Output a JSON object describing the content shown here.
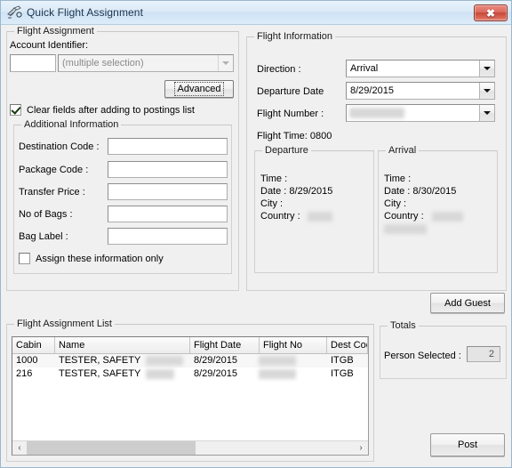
{
  "window": {
    "title": "Quick Flight Assignment",
    "icon": "flight-assignment-icon",
    "close_label": "✕"
  },
  "flight_assignment": {
    "group_title": "Flight Assignment",
    "account_identifier_label": "Account Identifier:",
    "account_identifier_value": "",
    "account_selection_value": "(multiple selection)",
    "advanced_button": "Advanced",
    "clear_fields_checkbox": {
      "label": "Clear fields after adding to postings list",
      "checked": true
    },
    "additional_information": {
      "group_title": "Additional Information",
      "fields": [
        {
          "label": "Destination Code :",
          "value": ""
        },
        {
          "label": "Package Code :",
          "value": ""
        },
        {
          "label": "Transfer Price :",
          "value": ""
        },
        {
          "label": "No of Bags :",
          "value": ""
        },
        {
          "label": "Bag Label :",
          "value": ""
        }
      ],
      "assign_only_checkbox": {
        "label": "Assign these information only",
        "checked": false
      }
    }
  },
  "flight_information": {
    "group_title": "Flight Information",
    "direction_label": "Direction :",
    "direction_value": "Arrival",
    "departure_date_label": "Departure Date",
    "departure_date_value": "8/29/2015",
    "flight_number_label": "Flight Number :",
    "flight_number_value": "",
    "flight_time_text": "Flight Time: 0800",
    "departure": {
      "group_title": "Departure",
      "time_label": "Time :",
      "time_value": "",
      "date_label": "Date : 8/29/2015",
      "city_label": "City :",
      "city_value": "",
      "country_label": "Country :",
      "country_value": ""
    },
    "arrival": {
      "group_title": "Arrival",
      "time_label": "Time :",
      "time_value": "",
      "date_label": "Date : 8/30/2015",
      "city_label": "City :",
      "city_value": "",
      "country_label": "Country :",
      "country_value": ""
    },
    "add_guest_button": "Add Guest"
  },
  "flight_assignment_list": {
    "group_title": "Flight Assignment List",
    "columns": [
      "Cabin",
      "Name",
      "Flight Date",
      "Flight No",
      "Dest Cod"
    ],
    "rows": [
      {
        "cabin": "1000",
        "name": "TESTER, SAFETY",
        "flight_date": "8/29/2015",
        "flight_no": "",
        "dest_code": "ITGB"
      },
      {
        "cabin": "216",
        "name": "TESTER, SAFETY",
        "flight_date": "8/29/2015",
        "flight_no": "",
        "dest_code": "ITGB"
      }
    ],
    "scroll_left_icon": "‹",
    "scroll_right_icon": "›"
  },
  "totals": {
    "group_title": "Totals",
    "person_selected_label": "Person Selected :",
    "person_selected_value": "2"
  },
  "post_button": "Post"
}
